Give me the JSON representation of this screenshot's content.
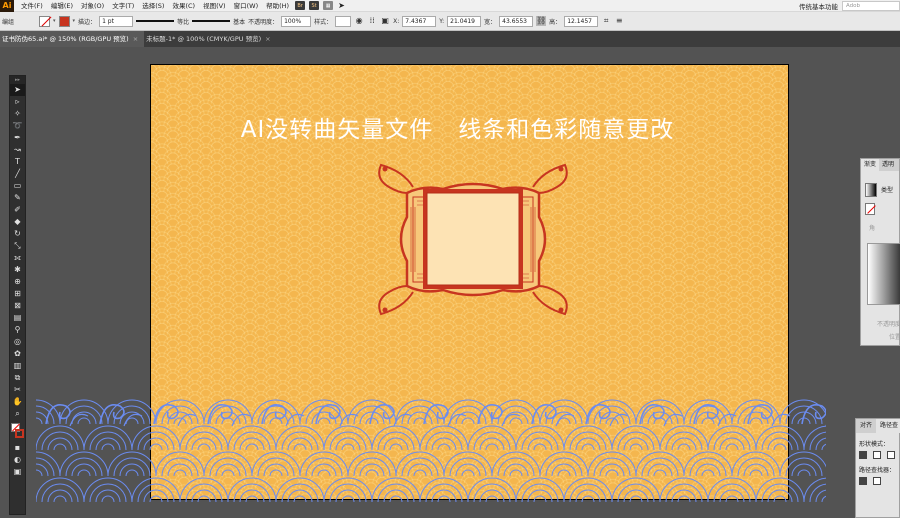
{
  "menubar": {
    "logo": "Ai",
    "items": [
      "文件(F)",
      "编辑(E)",
      "对象(O)",
      "文字(T)",
      "选择(S)",
      "效果(C)",
      "视图(V)",
      "窗口(W)",
      "帮助(H)"
    ],
    "app_buttons": [
      "Br",
      "St"
    ],
    "workspace": "传统基本功能",
    "search_placeholder": "Adob"
  },
  "controlbar": {
    "selection_label": "编组",
    "stroke_label": "描边：",
    "stroke_weight": "1 pt",
    "profile_label": "等比",
    "brush_label": "基本",
    "opacity_label": "不透明度：",
    "opacity_value": "100%",
    "style_label": "样式：",
    "x_label": "X:",
    "x_value": "7.4367",
    "y_label": "Y:",
    "y_value": "21.0419",
    "w_label": "宽：",
    "w_value": "43.6553",
    "h_label": "高：",
    "h_value": "12.1457"
  },
  "tabs": [
    {
      "label": "证书防伪65.ai* @ 150% (RGB/GPU 预览)",
      "close": "×"
    },
    {
      "label": "未标题-1* @ 100% (CMYK/GPU 预览)",
      "close": "×"
    }
  ],
  "tools": {
    "grip": "▸▸",
    "icons": [
      "selection-arrow",
      "direct-selection",
      "magic-wand",
      "lasso",
      "pen",
      "curvature",
      "type",
      "line",
      "rectangle",
      "paintbrush",
      "shaper",
      "eraser",
      "rotate",
      "scale",
      "width",
      "puppet-warp",
      "shape-builder",
      "perspective",
      "mesh",
      "gradient",
      "eyedropper",
      "blend",
      "symbol-sprayer",
      "column-graph",
      "artboard",
      "slice",
      "hand",
      "zoom"
    ]
  },
  "artboard": {
    "headline": "AI没转曲矢量文件   线条和色彩随意更改",
    "background_color": "#f4b64e",
    "frame_color": "#c73520",
    "frame_fill": "#fde3b4",
    "wave_color": "#6b8cf0"
  },
  "gradient_panel": {
    "tabs": [
      "渐变",
      "透明"
    ],
    "type_label": "类型",
    "angle_label": "角",
    "opacity_label": "不透明度",
    "position_label": "位置"
  },
  "path_panel": {
    "tabs": [
      "对齐",
      "路径查"
    ],
    "shape_modes_label": "形状模式：",
    "pathfinder_label": "路径查找器："
  }
}
